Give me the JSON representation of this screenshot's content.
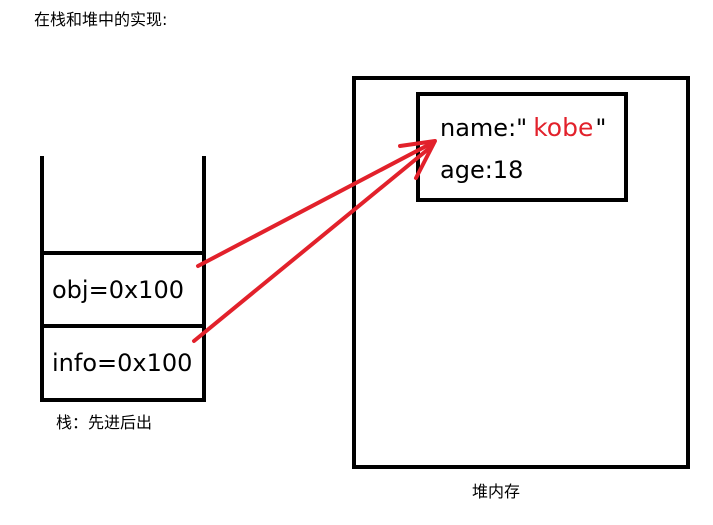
{
  "title": "在栈和堆中的实现:",
  "stack": {
    "cells": [
      {
        "label": "obj=0x100"
      },
      {
        "label": "info=0x100"
      }
    ],
    "caption": "栈：先进后出"
  },
  "heap": {
    "caption": "堆内存",
    "object": {
      "name_key": "name:\"",
      "name_value": "kobe",
      "name_close": "\"",
      "age": "age:18"
    }
  },
  "colors": {
    "arrow": "#e2212b",
    "value_text": "#e2212b",
    "outline": "#000000"
  }
}
